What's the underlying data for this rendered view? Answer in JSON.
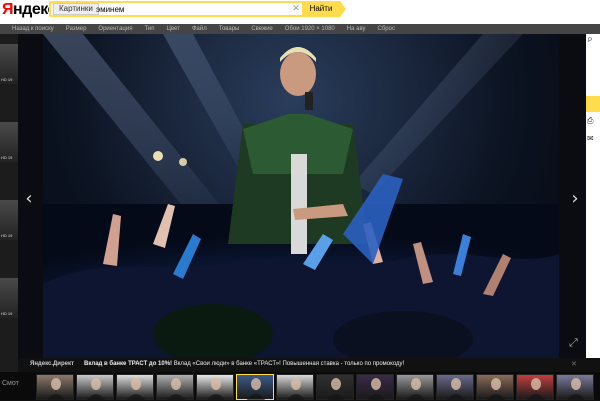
{
  "header": {
    "logo_first": "Я",
    "logo_rest": "ндекс",
    "search": {
      "tab_label": "Картинки",
      "query": "эминем",
      "button_label": "Найти"
    }
  },
  "filters": [
    "Назад к поиску",
    "Размер",
    "Ориентация",
    "Тип",
    "Цвет",
    "Файл",
    "Товары",
    "Свежие",
    "Обои 1920 × 1080",
    "На аву",
    "Сброс"
  ],
  "left_thumbs": [
    {
      "badge": "HD 19"
    },
    {
      "badge": "HD 19"
    },
    {
      "badge": "HD 19"
    },
    {
      "badge": "HD 19"
    }
  ],
  "right_panel": {
    "text": "Р",
    "icon1": "⎙",
    "icon2": "✉"
  },
  "ad": {
    "label": "Яндекс.Директ",
    "headline": "Вклад в банке ТРАСТ до 10%!",
    "text": " Вклад «Свои люди» в банке «ТРАСТ»! Повышенная ставка - только по промокоду!"
  },
  "filmstrip": {
    "label": "Смот",
    "thumbs": [
      {
        "tone": "#8a7a6a",
        "active": false
      },
      {
        "tone": "#c9c9c9",
        "active": false
      },
      {
        "tone": "#dddddd",
        "active": false
      },
      {
        "tone": "#b0b0b0",
        "active": false
      },
      {
        "tone": "#e8e8e8",
        "active": false
      },
      {
        "tone": "#3a5a8a",
        "active": true
      },
      {
        "tone": "#d8d8d8",
        "active": false
      },
      {
        "tone": "#303030",
        "active": false
      },
      {
        "tone": "#3a2a4a",
        "active": false
      },
      {
        "tone": "#999999",
        "active": false
      },
      {
        "tone": "#6a6a8a",
        "active": false
      },
      {
        "tone": "#8a6a5a",
        "active": false
      },
      {
        "tone": "#c04040",
        "active": false
      },
      {
        "tone": "#7a7a9a",
        "active": false
      }
    ]
  },
  "colors": {
    "accent": "#ffdb4d",
    "logo_red": "#ff0000"
  }
}
